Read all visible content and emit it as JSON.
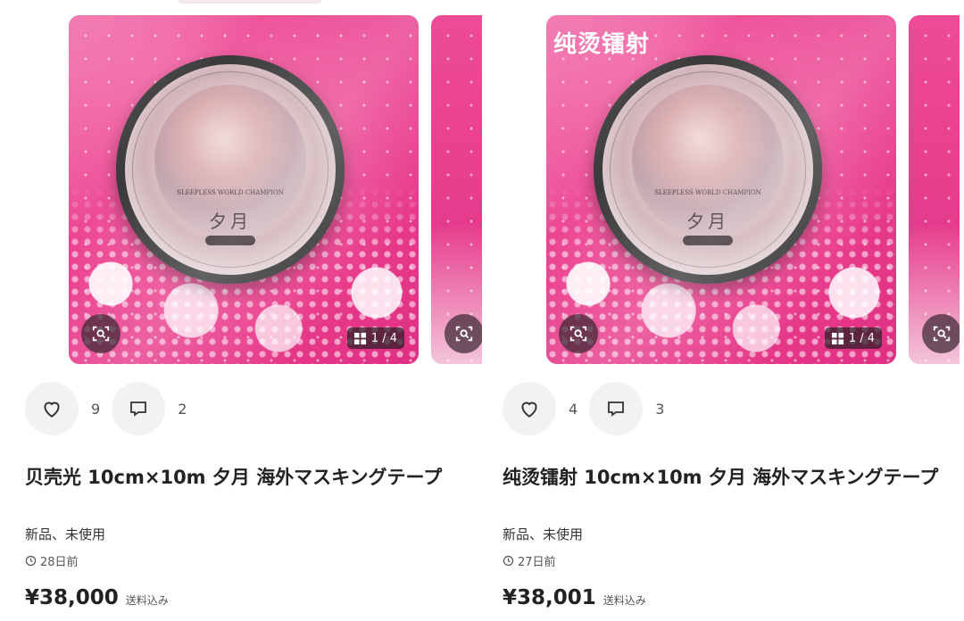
{
  "listings": [
    {
      "overlay_text": "",
      "image_counter": "1 / 4",
      "tape_label": "夕月",
      "tape_arc_text": "SLEEPLESS WORLD CHAMPION",
      "likes": "9",
      "comments": "2",
      "title": "贝壳光 10cm×10m 夕月 海外マスキングテープ",
      "condition": "新品、未使用",
      "posted": "28日前",
      "price": "¥38,000",
      "shipping": "送料込み"
    },
    {
      "overlay_text": "纯烫镭射",
      "image_counter": "1 / 4",
      "tape_label": "夕月",
      "tape_arc_text": "SLEEPLESS WORLD CHAMPION",
      "likes": "4",
      "comments": "3",
      "title": "纯烫镭射 10cm×10m 夕月 海外マスキングテープ",
      "condition": "新品、未使用",
      "posted": "27日前",
      "price": "¥38,001",
      "shipping": "送料込み"
    }
  ],
  "icons": {
    "lens": "image-search-icon",
    "gallery": "grid-icon",
    "like": "heart-icon",
    "comment": "comment-icon",
    "clock": "clock-icon"
  },
  "colors": {
    "image_background": "#e8408e",
    "text": "#222222",
    "button_background": "#f2f2f2"
  }
}
